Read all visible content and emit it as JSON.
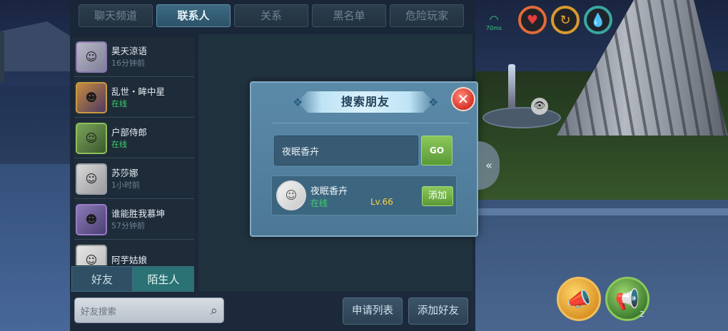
{
  "hud": {
    "ping": "70ms",
    "ping_color": "#3fd07a"
  },
  "tabs": [
    {
      "label": "聊天频道",
      "active": false
    },
    {
      "label": "联系人",
      "active": true
    },
    {
      "label": "关系",
      "active": false
    },
    {
      "label": "黑名单",
      "active": false
    },
    {
      "label": "危险玩家",
      "active": false
    }
  ],
  "contacts": [
    {
      "name": "昊天涼语",
      "status": "16分钟前",
      "online": false
    },
    {
      "name": "乱世・眸中星",
      "status": "在线",
      "online": true
    },
    {
      "name": "户部侍郎",
      "status": "在线",
      "online": true
    },
    {
      "name": "苏莎娜",
      "status": "1小时前",
      "online": false
    },
    {
      "name": "谁能胜我慕坤",
      "status": "57分钟前",
      "online": false
    },
    {
      "name": "阿芋姑娘",
      "status": "",
      "online": false
    }
  ],
  "bottom_tabs": {
    "friends": "好友",
    "strangers": "陌生人"
  },
  "search": {
    "placeholder": "好友搜索"
  },
  "actions": {
    "apply_list": "申请列表",
    "add_friend": "添加好友"
  },
  "modal": {
    "title": "搜索朋友",
    "input_value": "夜眠香卉",
    "go_label": "GO",
    "result": {
      "name": "夜眠香卉",
      "status": "在线",
      "level": "Lv.66",
      "add_label": "添加"
    }
  },
  "megaphone_count": "2",
  "colors": {
    "panel_bg": "#1a2737",
    "active_tab": "#3c6a82",
    "online": "#3fcf6a",
    "level": "#ffd040",
    "go_button": "#5a9a36",
    "close_button": "#d6322a"
  }
}
